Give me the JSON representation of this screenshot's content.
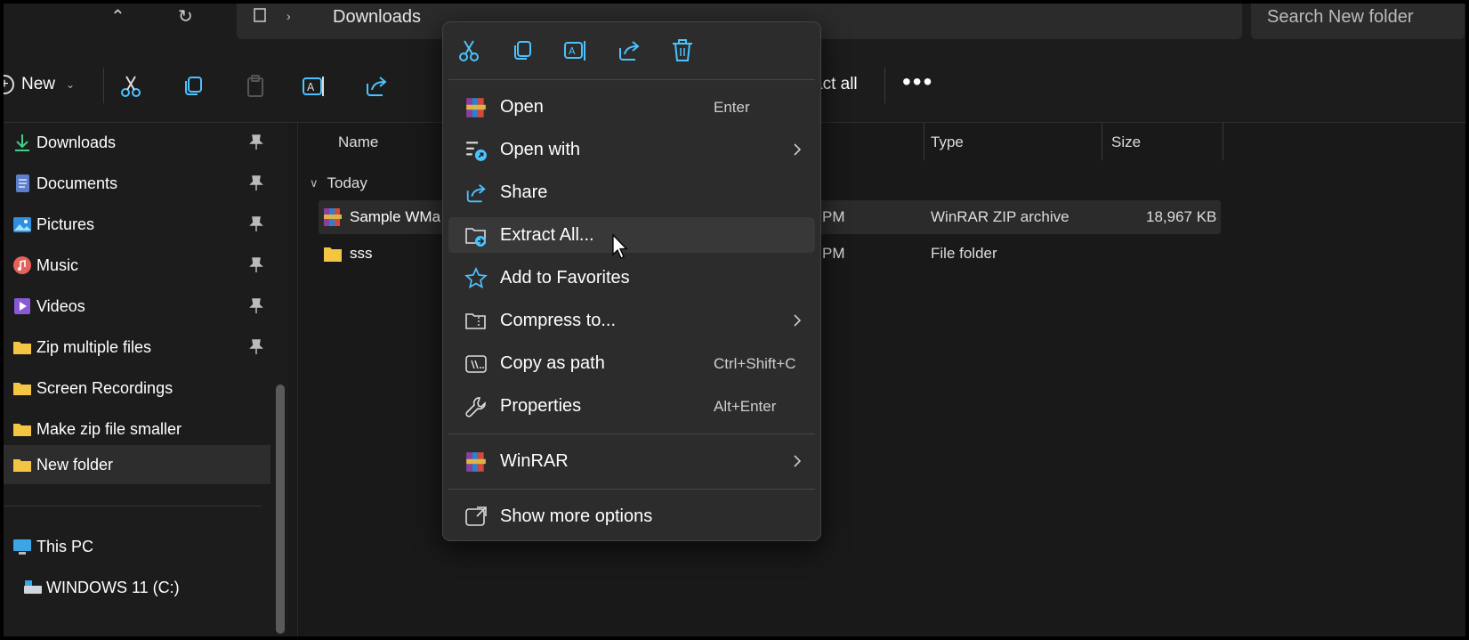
{
  "address": {
    "current_folder": "Downloads",
    "search_placeholder": "Search New folder"
  },
  "toolbar": {
    "new_label": "New",
    "extract_all_label": "act all",
    "more_label": "•••"
  },
  "nav": {
    "items": [
      {
        "label": "Downloads",
        "icon": "download-icon",
        "pinned": true
      },
      {
        "label": "Documents",
        "icon": "documents-icon",
        "pinned": true
      },
      {
        "label": "Pictures",
        "icon": "pictures-icon",
        "pinned": true
      },
      {
        "label": "Music",
        "icon": "music-icon",
        "pinned": true
      },
      {
        "label": "Videos",
        "icon": "videos-icon",
        "pinned": true
      },
      {
        "label": "Zip multiple files",
        "icon": "folder-icon",
        "pinned": true
      },
      {
        "label": "Screen Recordings",
        "icon": "folder-icon",
        "pinned": false
      },
      {
        "label": "Make zip file smaller",
        "icon": "folder-icon",
        "pinned": false
      },
      {
        "label": "New folder",
        "icon": "folder-icon",
        "pinned": false,
        "selected": true
      }
    ],
    "this_pc": "This PC",
    "drive": "WINDOWS 11 (C:)"
  },
  "list": {
    "columns": {
      "name": "Name",
      "type": "Type",
      "size": "Size"
    },
    "group": "Today",
    "rows": [
      {
        "name": "Sample WMa",
        "date": "PM",
        "type": "WinRAR ZIP archive",
        "size": "18,967 KB",
        "icon": "winrar-archive-icon"
      },
      {
        "name": "sss",
        "date": "PM",
        "type": "File folder",
        "size": "",
        "icon": "folder-icon"
      }
    ]
  },
  "context_menu": {
    "top_actions": [
      "cut-icon",
      "copy-icon",
      "rename-icon",
      "share-icon",
      "delete-icon"
    ],
    "items": [
      {
        "label": "Open",
        "shortcut": "Enter",
        "icon": "winrar-icon"
      },
      {
        "label": "Open with",
        "shortcut": "",
        "icon": "open-with-icon",
        "submenu": true
      },
      {
        "label": "Share",
        "shortcut": "",
        "icon": "share-icon"
      },
      {
        "label": "Extract All...",
        "shortcut": "",
        "icon": "extract-icon",
        "hover": true
      },
      {
        "label": "Add to Favorites",
        "shortcut": "",
        "icon": "star-icon"
      },
      {
        "label": "Compress to...",
        "shortcut": "",
        "icon": "compress-icon",
        "submenu": true
      },
      {
        "label": "Copy as path",
        "shortcut": "Ctrl+Shift+C",
        "icon": "copy-path-icon"
      },
      {
        "label": "Properties",
        "shortcut": "Alt+Enter",
        "icon": "wrench-icon"
      },
      {
        "label": "WinRAR",
        "shortcut": "",
        "icon": "winrar-icon",
        "submenu": true
      },
      {
        "label": "Show more options",
        "shortcut": "",
        "icon": "more-options-icon"
      }
    ]
  },
  "colors": {
    "accent": "#4cc2ff",
    "folder": "#f4c542",
    "background": "#191919",
    "menu": "#2c2c2c"
  }
}
